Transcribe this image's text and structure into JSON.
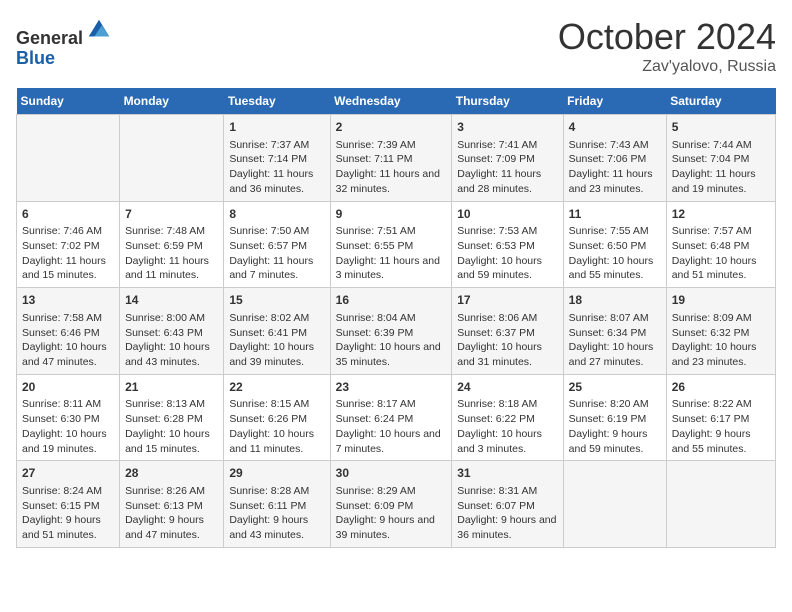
{
  "header": {
    "logo_line1": "General",
    "logo_line2": "Blue",
    "month": "October 2024",
    "location": "Zav'yalovo, Russia"
  },
  "days_of_week": [
    "Sunday",
    "Monday",
    "Tuesday",
    "Wednesday",
    "Thursday",
    "Friday",
    "Saturday"
  ],
  "weeks": [
    [
      {
        "day": "",
        "content": ""
      },
      {
        "day": "",
        "content": ""
      },
      {
        "day": "1",
        "content": "Sunrise: 7:37 AM\nSunset: 7:14 PM\nDaylight: 11 hours and 36 minutes."
      },
      {
        "day": "2",
        "content": "Sunrise: 7:39 AM\nSunset: 7:11 PM\nDaylight: 11 hours and 32 minutes."
      },
      {
        "day": "3",
        "content": "Sunrise: 7:41 AM\nSunset: 7:09 PM\nDaylight: 11 hours and 28 minutes."
      },
      {
        "day": "4",
        "content": "Sunrise: 7:43 AM\nSunset: 7:06 PM\nDaylight: 11 hours and 23 minutes."
      },
      {
        "day": "5",
        "content": "Sunrise: 7:44 AM\nSunset: 7:04 PM\nDaylight: 11 hours and 19 minutes."
      }
    ],
    [
      {
        "day": "6",
        "content": "Sunrise: 7:46 AM\nSunset: 7:02 PM\nDaylight: 11 hours and 15 minutes."
      },
      {
        "day": "7",
        "content": "Sunrise: 7:48 AM\nSunset: 6:59 PM\nDaylight: 11 hours and 11 minutes."
      },
      {
        "day": "8",
        "content": "Sunrise: 7:50 AM\nSunset: 6:57 PM\nDaylight: 11 hours and 7 minutes."
      },
      {
        "day": "9",
        "content": "Sunrise: 7:51 AM\nSunset: 6:55 PM\nDaylight: 11 hours and 3 minutes."
      },
      {
        "day": "10",
        "content": "Sunrise: 7:53 AM\nSunset: 6:53 PM\nDaylight: 10 hours and 59 minutes."
      },
      {
        "day": "11",
        "content": "Sunrise: 7:55 AM\nSunset: 6:50 PM\nDaylight: 10 hours and 55 minutes."
      },
      {
        "day": "12",
        "content": "Sunrise: 7:57 AM\nSunset: 6:48 PM\nDaylight: 10 hours and 51 minutes."
      }
    ],
    [
      {
        "day": "13",
        "content": "Sunrise: 7:58 AM\nSunset: 6:46 PM\nDaylight: 10 hours and 47 minutes."
      },
      {
        "day": "14",
        "content": "Sunrise: 8:00 AM\nSunset: 6:43 PM\nDaylight: 10 hours and 43 minutes."
      },
      {
        "day": "15",
        "content": "Sunrise: 8:02 AM\nSunset: 6:41 PM\nDaylight: 10 hours and 39 minutes."
      },
      {
        "day": "16",
        "content": "Sunrise: 8:04 AM\nSunset: 6:39 PM\nDaylight: 10 hours and 35 minutes."
      },
      {
        "day": "17",
        "content": "Sunrise: 8:06 AM\nSunset: 6:37 PM\nDaylight: 10 hours and 31 minutes."
      },
      {
        "day": "18",
        "content": "Sunrise: 8:07 AM\nSunset: 6:34 PM\nDaylight: 10 hours and 27 minutes."
      },
      {
        "day": "19",
        "content": "Sunrise: 8:09 AM\nSunset: 6:32 PM\nDaylight: 10 hours and 23 minutes."
      }
    ],
    [
      {
        "day": "20",
        "content": "Sunrise: 8:11 AM\nSunset: 6:30 PM\nDaylight: 10 hours and 19 minutes."
      },
      {
        "day": "21",
        "content": "Sunrise: 8:13 AM\nSunset: 6:28 PM\nDaylight: 10 hours and 15 minutes."
      },
      {
        "day": "22",
        "content": "Sunrise: 8:15 AM\nSunset: 6:26 PM\nDaylight: 10 hours and 11 minutes."
      },
      {
        "day": "23",
        "content": "Sunrise: 8:17 AM\nSunset: 6:24 PM\nDaylight: 10 hours and 7 minutes."
      },
      {
        "day": "24",
        "content": "Sunrise: 8:18 AM\nSunset: 6:22 PM\nDaylight: 10 hours and 3 minutes."
      },
      {
        "day": "25",
        "content": "Sunrise: 8:20 AM\nSunset: 6:19 PM\nDaylight: 9 hours and 59 minutes."
      },
      {
        "day": "26",
        "content": "Sunrise: 8:22 AM\nSunset: 6:17 PM\nDaylight: 9 hours and 55 minutes."
      }
    ],
    [
      {
        "day": "27",
        "content": "Sunrise: 8:24 AM\nSunset: 6:15 PM\nDaylight: 9 hours and 51 minutes."
      },
      {
        "day": "28",
        "content": "Sunrise: 8:26 AM\nSunset: 6:13 PM\nDaylight: 9 hours and 47 minutes."
      },
      {
        "day": "29",
        "content": "Sunrise: 8:28 AM\nSunset: 6:11 PM\nDaylight: 9 hours and 43 minutes."
      },
      {
        "day": "30",
        "content": "Sunrise: 8:29 AM\nSunset: 6:09 PM\nDaylight: 9 hours and 39 minutes."
      },
      {
        "day": "31",
        "content": "Sunrise: 8:31 AM\nSunset: 6:07 PM\nDaylight: 9 hours and 36 minutes."
      },
      {
        "day": "",
        "content": ""
      },
      {
        "day": "",
        "content": ""
      }
    ]
  ]
}
